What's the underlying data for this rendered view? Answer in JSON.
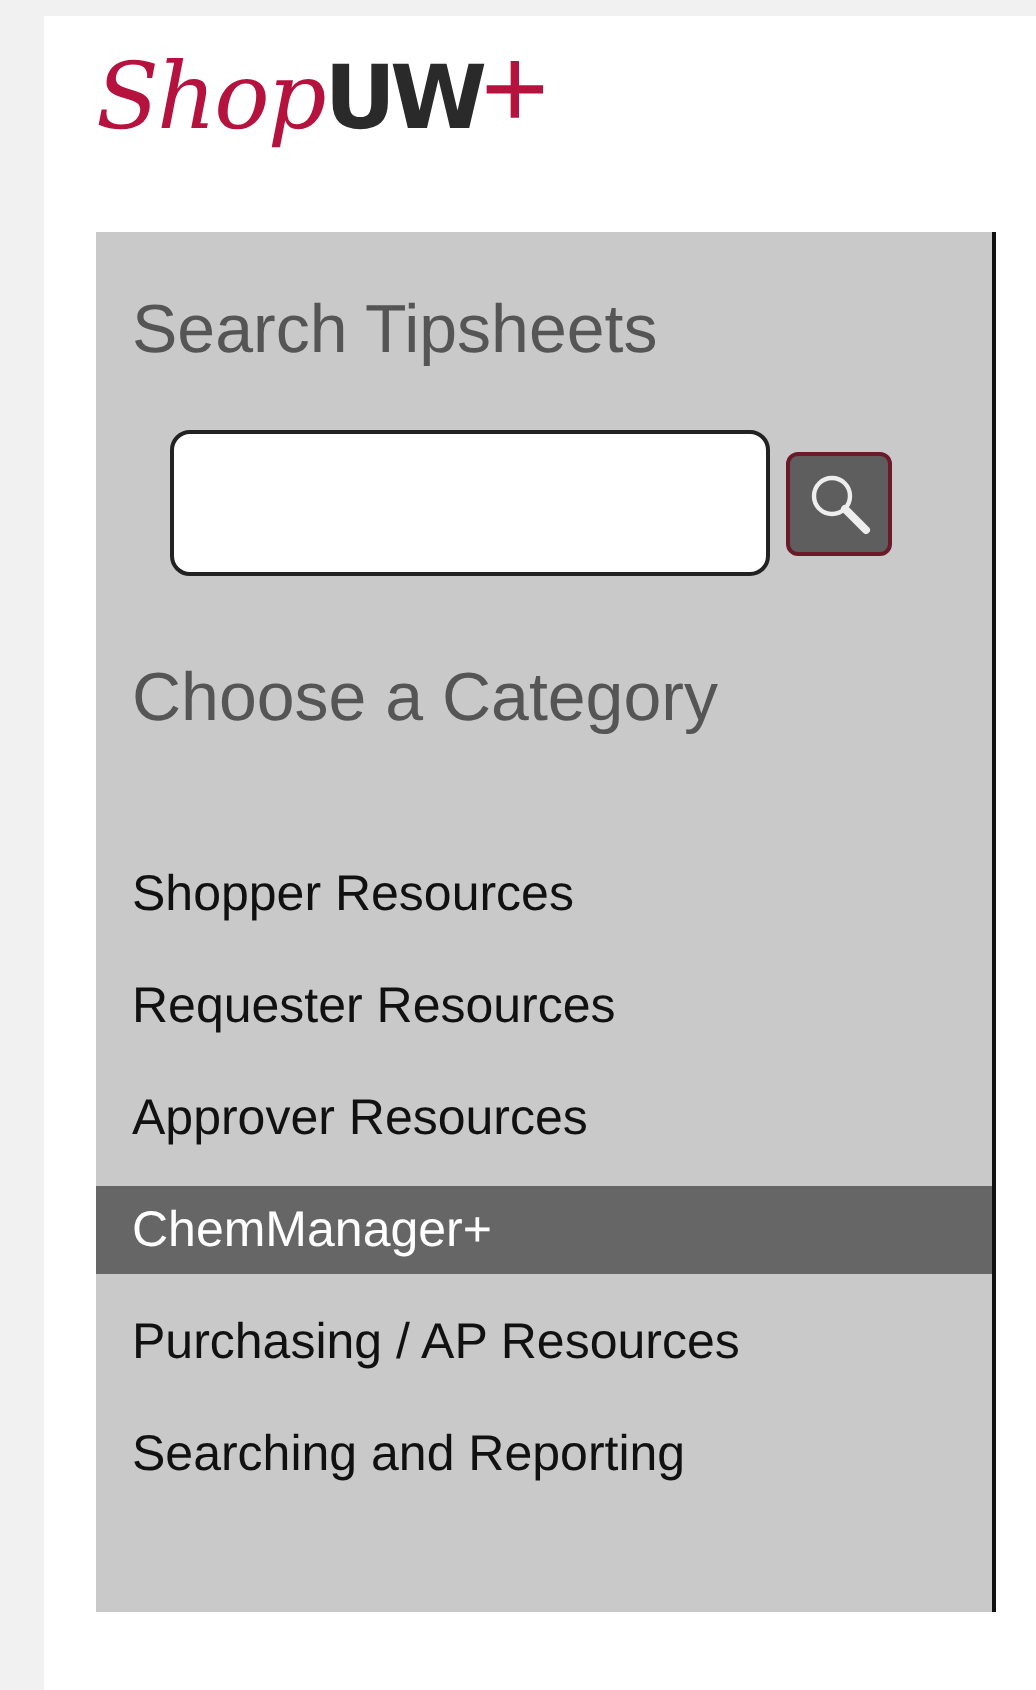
{
  "logo": {
    "script": "Shop",
    "bold": "UW",
    "mark": "+"
  },
  "search": {
    "heading": "Search Tipsheets"
  },
  "categories": {
    "heading": "Choose a Category",
    "items": [
      {
        "label": "Shopper Resources",
        "selected": false
      },
      {
        "label": "Requester Resources",
        "selected": false
      },
      {
        "label": "Approver Resources",
        "selected": false
      },
      {
        "label": "ChemManager+",
        "selected": true
      },
      {
        "label": "Purchasing / AP Resources",
        "selected": false
      },
      {
        "label": "Searching and Reporting",
        "selected": false
      }
    ]
  }
}
